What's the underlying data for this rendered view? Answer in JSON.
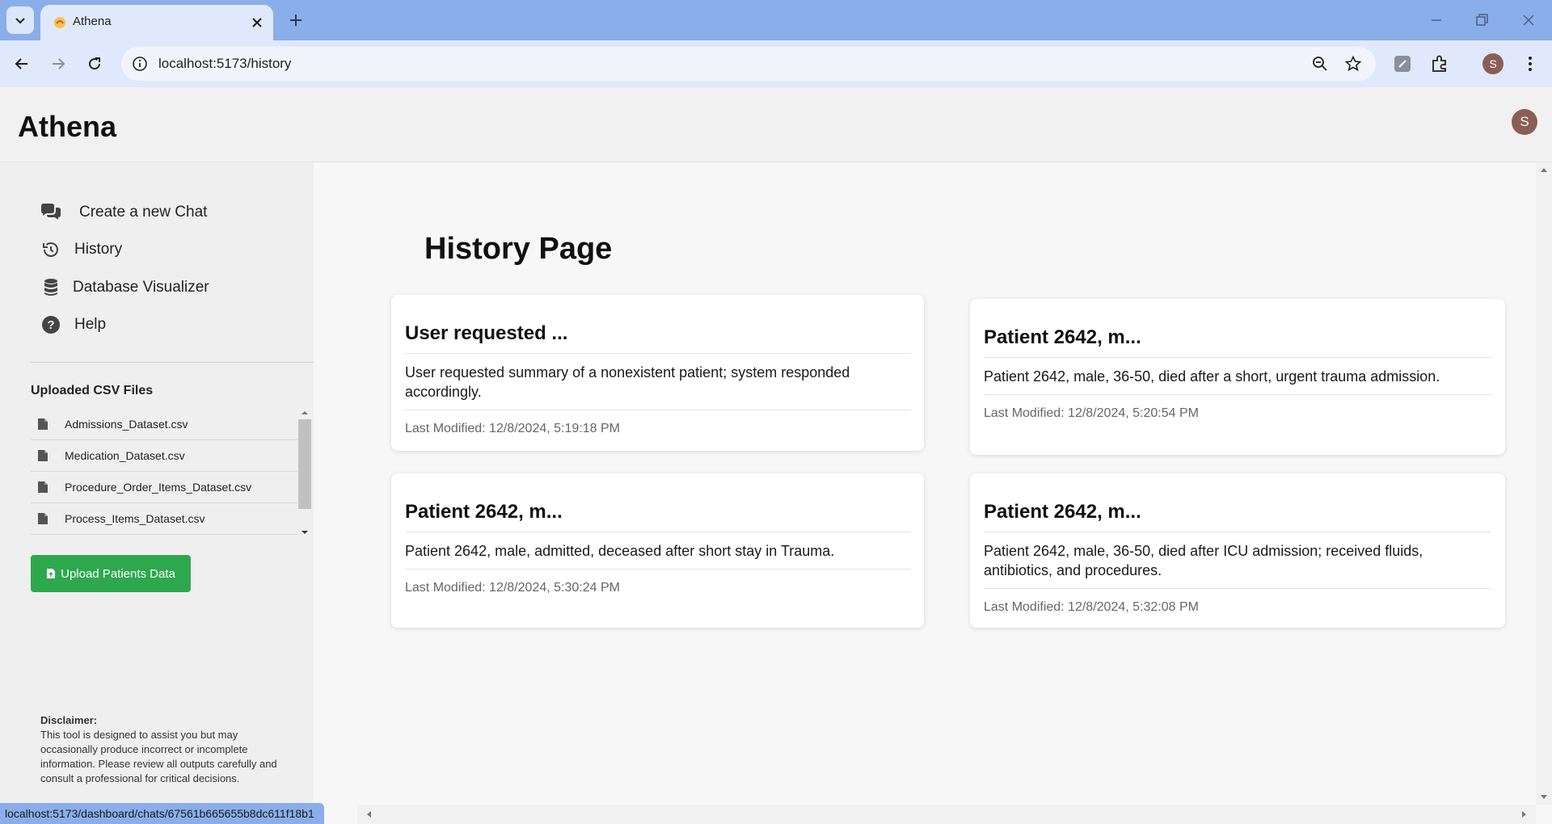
{
  "browser": {
    "tab_title": "Athena",
    "url": "localhost:5173/history",
    "profile_initial": "S"
  },
  "header": {
    "app_title": "Athena",
    "user_initial": "S"
  },
  "sidebar": {
    "nav": [
      {
        "label": "Create a new Chat",
        "icon": "chat-bubbles-icon"
      },
      {
        "label": "History",
        "icon": "history-icon"
      },
      {
        "label": "Database Visualizer",
        "icon": "database-icon"
      },
      {
        "label": "Help",
        "icon": "help-icon"
      }
    ],
    "csv_title": "Uploaded CSV Files",
    "csv_files": [
      "Admissions_Dataset.csv",
      "Medication_Dataset.csv",
      "Procedure_Order_Items_Dataset.csv",
      "Process_Items_Dataset.csv"
    ],
    "upload_label": "Upload Patients Data",
    "disclaimer_heading": "Disclaimer:",
    "disclaimer_text": "This tool is designed to assist you but may occasionally produce incorrect or incomplete information. Please review all outputs carefully and consult a professional for critical decisions."
  },
  "main": {
    "page_title": "History Page",
    "cards": [
      {
        "title": "User requested ...",
        "summary": "User requested summary of a nonexistent patient; system responded accordingly.",
        "modified": "Last Modified: 12/8/2024, 5:19:18 PM"
      },
      {
        "title": "Patient 2642, m...",
        "summary": "Patient 2642, male, 36-50, died after a short, urgent trauma admission.",
        "modified": "Last Modified: 12/8/2024, 5:20:54 PM"
      },
      {
        "title": "Patient 2642, m...",
        "summary": "Patient 2642, male, admitted, deceased after short stay in Trauma.",
        "modified": "Last Modified: 12/8/2024, 5:30:24 PM"
      },
      {
        "title": "Patient 2642, m...",
        "summary": "Patient 2642, male, 36-50, died after ICU admission; received fluids, antibiotics, and procedures.",
        "modified": "Last Modified: 12/8/2024, 5:32:08 PM"
      }
    ]
  },
  "status_bar": {
    "hover_url": "localhost:5173/dashboard/chats/67561b665655b8dc611f18b1"
  },
  "colors": {
    "browser_frame": "#8aaeea",
    "upload_button": "#2ea84d",
    "avatar": "#8b5e55"
  }
}
